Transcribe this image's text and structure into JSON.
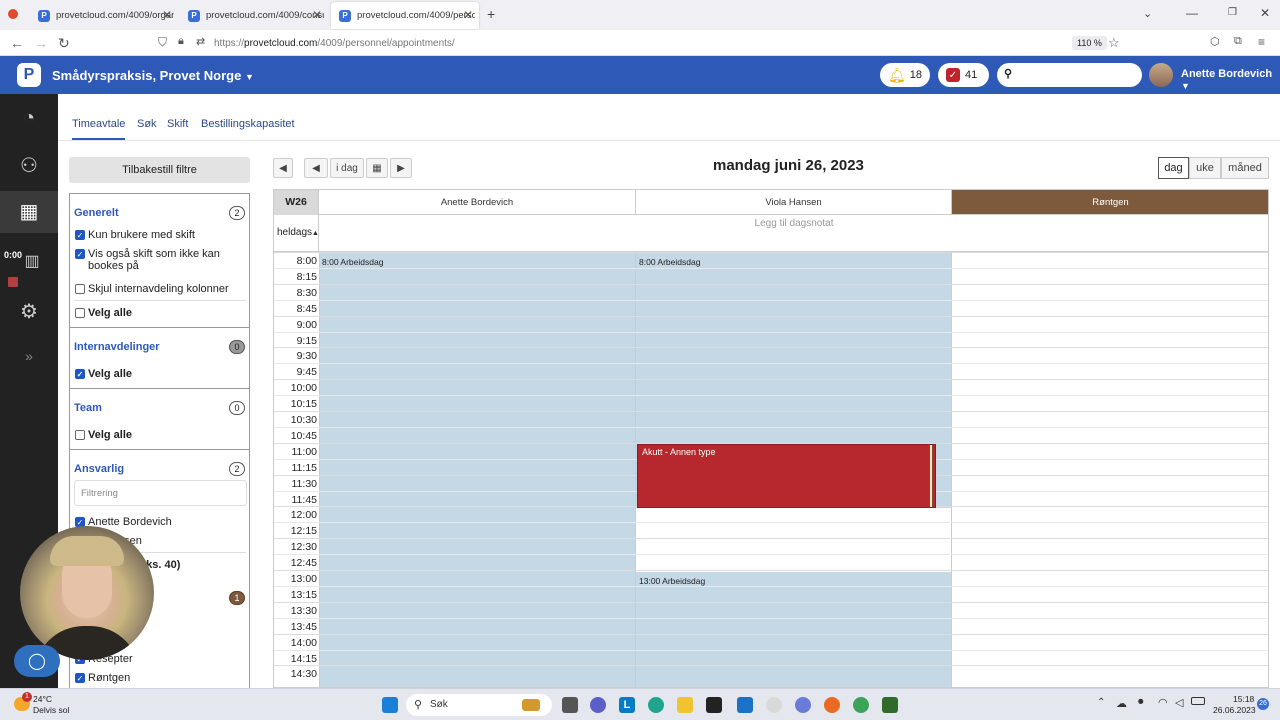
{
  "browser": {
    "tabs": [
      {
        "title": "provetcloud.com/4009/organiz"
      },
      {
        "title": "provetcloud.com/4009/consult"
      },
      {
        "title": "provetcloud.com/4009/personn"
      }
    ],
    "url_prefix": "https://",
    "url_host": "provetcloud.com",
    "url_path": "/4009/personnel/appointments/",
    "zoom": "110 %"
  },
  "header": {
    "org_name": "Smådyrspraksis, Provet Norge",
    "notifications_count": "18",
    "tasks_count": "41",
    "user_name": "Anette Bordevich"
  },
  "left_nav": {
    "timer": "0:00"
  },
  "subtabs": [
    "Timeavtale",
    "Søk",
    "Skift",
    "Bestillingskapasitet"
  ],
  "filters": {
    "reset_label": "Tilbakestill filtre",
    "generelt": {
      "title": "Generelt",
      "count": "2",
      "items": [
        "Kun brukere med skift",
        "Vis også skift som ikke kan bookes på",
        "Skjul internavdeling kolonner"
      ],
      "select_all": "Velg alle"
    },
    "internavdelinger": {
      "title": "Internavdelinger",
      "count": "0",
      "select_all": "Velg alle"
    },
    "team": {
      "title": "Team",
      "count": "0",
      "select_all": "Velg alle"
    },
    "ansvarlig": {
      "title": "Ansvarlig",
      "count": "2",
      "filter_placeholder": "Filtrering",
      "items": [
        "Anette Bordevich",
        "nsen"
      ],
      "select_max": "aks. 40)"
    },
    "ressurser": {
      "count": "1",
      "items": [
        "Resepter",
        "Røntgen"
      ]
    }
  },
  "calendar": {
    "nav_today": "i dag",
    "date_title": "mandag juni 26, 2023",
    "views": [
      "dag",
      "uke",
      "måned"
    ],
    "week": "W26",
    "allday_label": "heldags",
    "day_note": "Legg til dagsnotat",
    "columns": [
      "Anette Bordevich",
      "Viola Hansen",
      "Røntgen"
    ],
    "times": [
      "8:00",
      "8:15",
      "8:30",
      "8:45",
      "9:00",
      "9:15",
      "9:30",
      "9:45",
      "10:00",
      "10:15",
      "10:30",
      "10:45",
      "11:00",
      "11:15",
      "11:30",
      "11:45",
      "12:00",
      "12:15",
      "12:30",
      "12:45",
      "13:00",
      "13:15",
      "13:30",
      "13:45",
      "14:00",
      "14:15",
      "14:30"
    ],
    "shift_labels": {
      "col0": "8:00 Arbeidsdag",
      "col1_morning": "8:00 Arbeidsdag",
      "col1_afternoon": "13:00 Arbeidsdag"
    },
    "appointment": {
      "title": "Akutt - Annen type",
      "color": "#b7282e"
    },
    "rontgen_color": "#7d5a3c",
    "shift_color": "#c5d8e6"
  },
  "taskbar": {
    "weather_temp": "24°C",
    "weather_desc": "Delvis sol",
    "search_label": "Søk",
    "time": "15:18",
    "date": "26.06.2023",
    "badge": "1"
  }
}
